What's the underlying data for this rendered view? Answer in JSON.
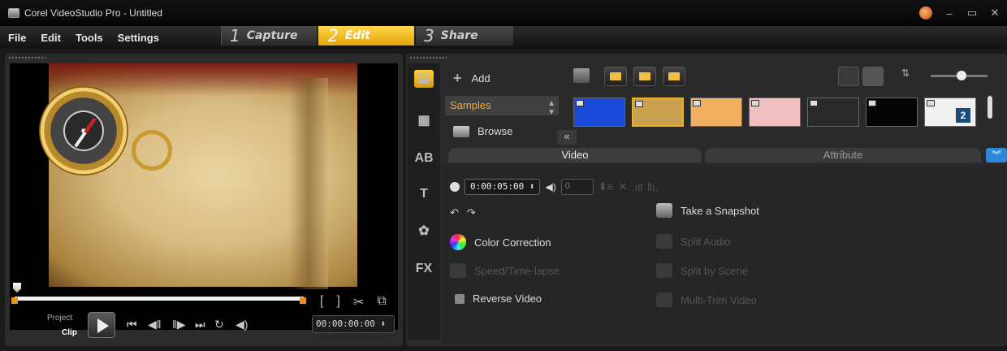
{
  "window": {
    "title": "Corel VideoStudio Pro - Untitled",
    "controls": [
      "–",
      "▭",
      "✕"
    ]
  },
  "menu": {
    "items": [
      "File",
      "Edit",
      "Tools",
      "Settings"
    ]
  },
  "steps": [
    {
      "number": "1",
      "label": "Capture"
    },
    {
      "number": "2",
      "label": "Edit"
    },
    {
      "number": "3",
      "label": "Share"
    }
  ],
  "player": {
    "mode_project": "Project",
    "mode_clip": "Clip",
    "timecode": "00:00:00:00 ⬍",
    "mark_in": "[",
    "mark_out": "]",
    "scrub_progress": 0.0
  },
  "library": {
    "add_label": "Add",
    "folder_selected": "Samples",
    "browse_label": "Browse",
    "collapse_label": "«",
    "thumbnails": [
      {
        "name": "blue",
        "color": "#1a4ad8",
        "selected": false
      },
      {
        "name": "compass",
        "color": "#c8a050",
        "selected": true
      },
      {
        "name": "orange",
        "color": "#f0b060",
        "selected": false
      },
      {
        "name": "pink",
        "color": "#f0c0c0",
        "selected": false
      },
      {
        "name": "dark-streak",
        "color": "#2a2a2a",
        "selected": false
      },
      {
        "name": "black",
        "color": "#050505",
        "selected": false
      },
      {
        "name": "numbered",
        "color": "#f0f0f0",
        "selected": false,
        "badge": "2"
      }
    ]
  },
  "options": {
    "tab_video": "Video",
    "tab_attribute": "Attribute",
    "duration": "0:00:05:00 ⬍",
    "volume": "0",
    "take_snapshot": "Take a Snapshot",
    "color_correction": "Color Correction",
    "split_audio": "Split Audio",
    "speed_timelapse": "Speed/Time-lapse",
    "split_by_scene": "Split by Scene",
    "reverse_video": "Reverse Video",
    "multi_trim": "Multi-Trim Video"
  },
  "colors": {
    "accent": "#f0b020",
    "edit_tab": "#ffd64a",
    "expand_button": "#2b88d8"
  }
}
